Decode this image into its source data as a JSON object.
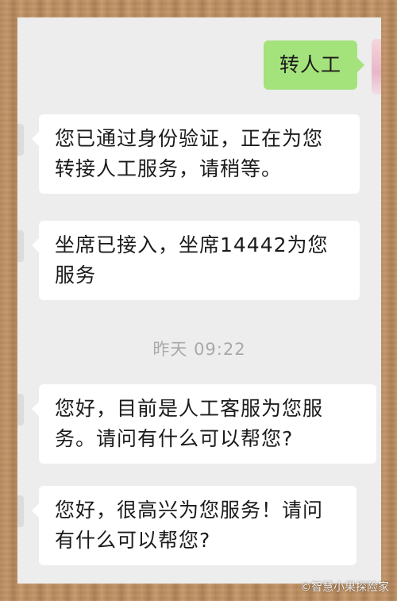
{
  "conversation": {
    "outgoing_message": "转人工",
    "messages": [
      "您已通过身份验证，正在为您转接人工服务，请稍等。",
      "坐席已接入，坐席14442为您服务",
      "您好，目前是人工客服为您服务。请问有什么可以帮您?",
      "您好，很高兴为您服务！请问有什么可以帮您?"
    ],
    "timestamp": "昨天 09:22"
  },
  "watermark": "©智慧小果探险家",
  "colors": {
    "chat_background": "#ededed",
    "incoming_bubble": "#ffffff",
    "outgoing_bubble": "#a4e27c",
    "timestamp_text": "#a9a9a9"
  }
}
